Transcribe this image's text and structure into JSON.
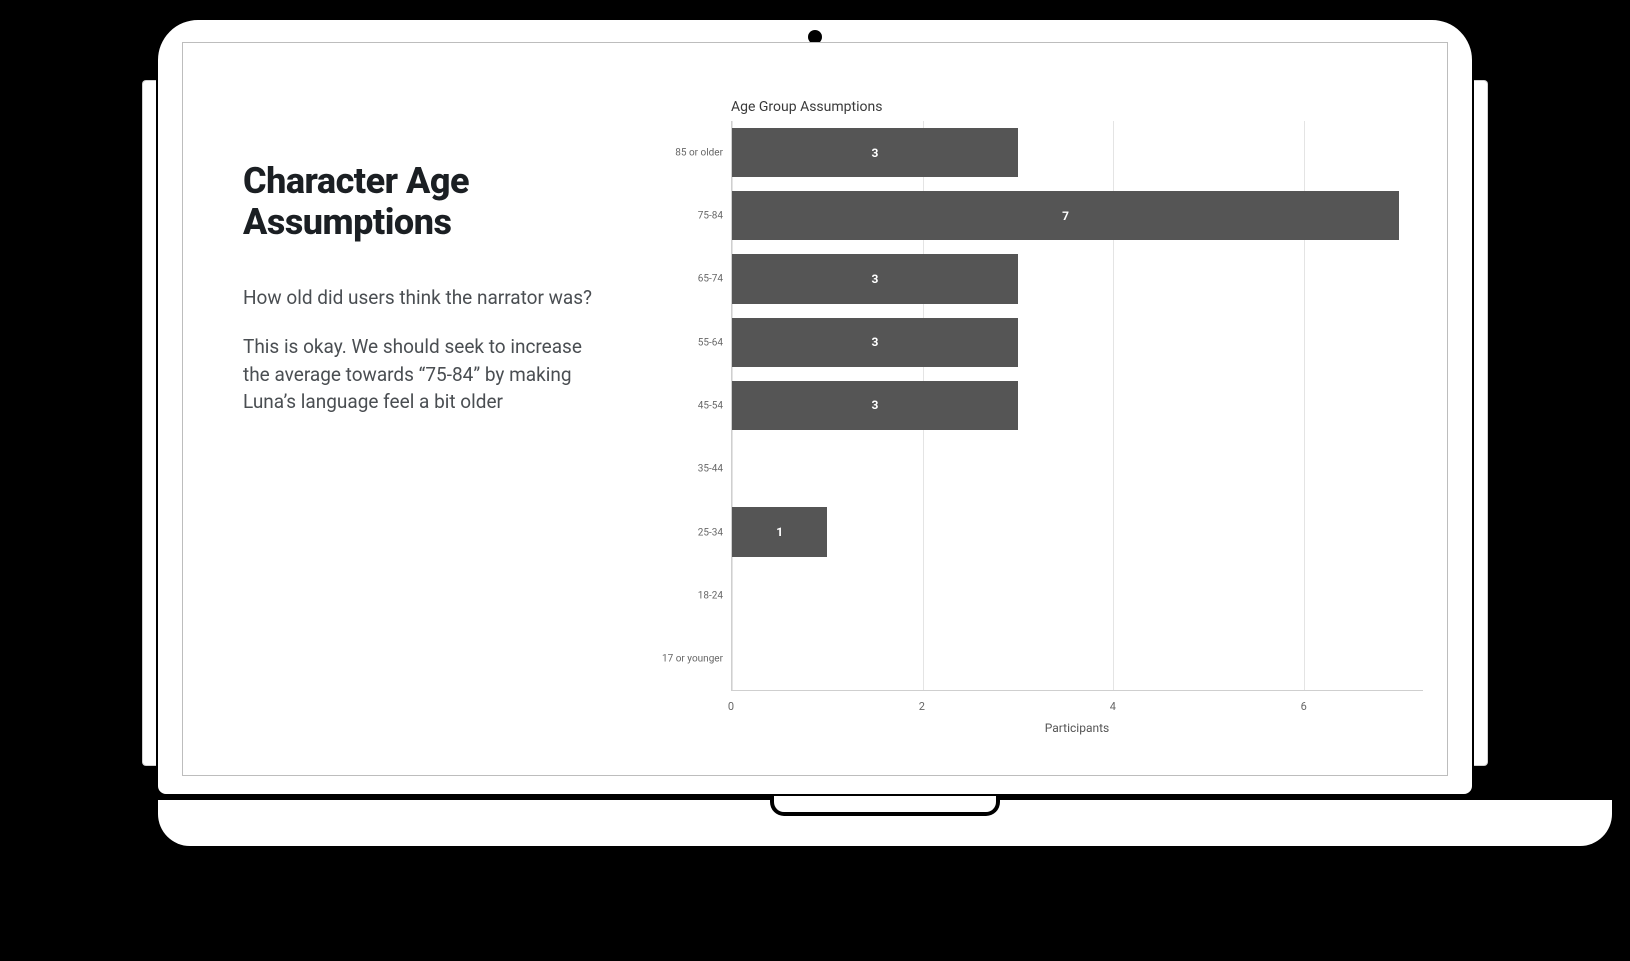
{
  "slide": {
    "title": "Character Age Assumptions",
    "paragraphs": [
      "How old did users think the narrator was?",
      "This is okay. We should seek to increase the average towards “75-84” by making Luna’s language feel a bit older"
    ]
  },
  "chart_data": {
    "type": "bar",
    "orientation": "horizontal",
    "title": "Age Group Assumptions",
    "xlabel": "Participants",
    "ylabel": "",
    "xlim": [
      0,
      7.25
    ],
    "x_ticks": [
      0,
      2,
      4,
      6
    ],
    "categories": [
      "85 or older",
      "75-84",
      "65-74",
      "55-64",
      "45-54",
      "35-44",
      "25-34",
      "18-24",
      "17 or younger"
    ],
    "values": [
      3,
      7,
      3,
      3,
      3,
      0,
      1,
      0,
      0
    ],
    "bar_color": "#555555"
  }
}
